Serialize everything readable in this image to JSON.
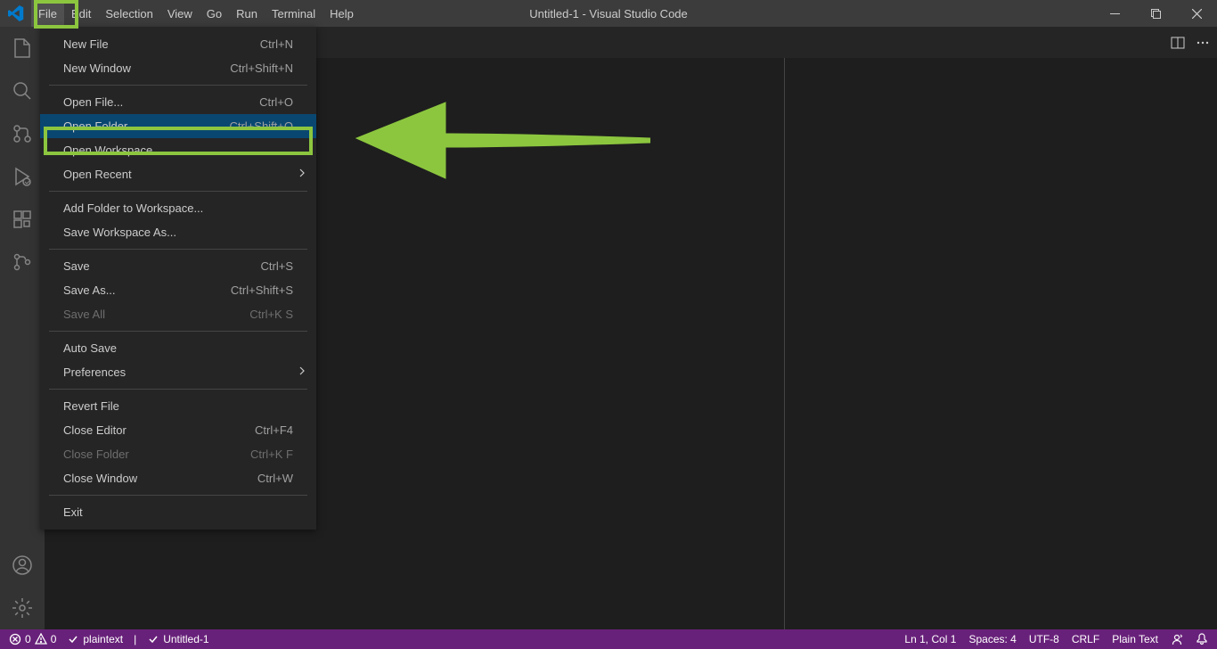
{
  "titlebar": {
    "title": "Untitled-1 - Visual Studio Code"
  },
  "menubar": {
    "items": [
      "File",
      "Edit",
      "Selection",
      "View",
      "Go",
      "Run",
      "Terminal",
      "Help"
    ]
  },
  "file_menu": {
    "items": [
      {
        "label": "New File",
        "shortcut": "Ctrl+N",
        "type": "item"
      },
      {
        "label": "New Window",
        "shortcut": "Ctrl+Shift+N",
        "type": "item"
      },
      {
        "type": "separator"
      },
      {
        "label": "Open File...",
        "shortcut": "Ctrl+O",
        "type": "item"
      },
      {
        "label": "Open Folder...",
        "shortcut": "Ctrl+Shift+O",
        "type": "item",
        "highlighted": true
      },
      {
        "label": "Open Workspace...",
        "shortcut": "",
        "type": "item"
      },
      {
        "label": "Open Recent",
        "shortcut": "",
        "type": "submenu"
      },
      {
        "type": "separator"
      },
      {
        "label": "Add Folder to Workspace...",
        "shortcut": "",
        "type": "item"
      },
      {
        "label": "Save Workspace As...",
        "shortcut": "",
        "type": "item"
      },
      {
        "type": "separator"
      },
      {
        "label": "Save",
        "shortcut": "Ctrl+S",
        "type": "item"
      },
      {
        "label": "Save As...",
        "shortcut": "Ctrl+Shift+S",
        "type": "item"
      },
      {
        "label": "Save All",
        "shortcut": "Ctrl+K S",
        "type": "item",
        "disabled": true
      },
      {
        "type": "separator"
      },
      {
        "label": "Auto Save",
        "shortcut": "",
        "type": "item"
      },
      {
        "label": "Preferences",
        "shortcut": "",
        "type": "submenu"
      },
      {
        "type": "separator"
      },
      {
        "label": "Revert File",
        "shortcut": "",
        "type": "item"
      },
      {
        "label": "Close Editor",
        "shortcut": "Ctrl+F4",
        "type": "item"
      },
      {
        "label": "Close Folder",
        "shortcut": "Ctrl+K F",
        "type": "item",
        "disabled": true
      },
      {
        "label": "Close Window",
        "shortcut": "Ctrl+W",
        "type": "item"
      },
      {
        "type": "separator"
      },
      {
        "label": "Exit",
        "shortcut": "",
        "type": "item"
      }
    ]
  },
  "statusbar": {
    "errors": "0",
    "warnings": "0",
    "language_mode": "plaintext",
    "file": "Untitled-1",
    "cursor": "Ln 1, Col 1",
    "spaces": "Spaces: 4",
    "encoding": "UTF-8",
    "eol": "CRLF",
    "filetype": "Plain Text"
  }
}
